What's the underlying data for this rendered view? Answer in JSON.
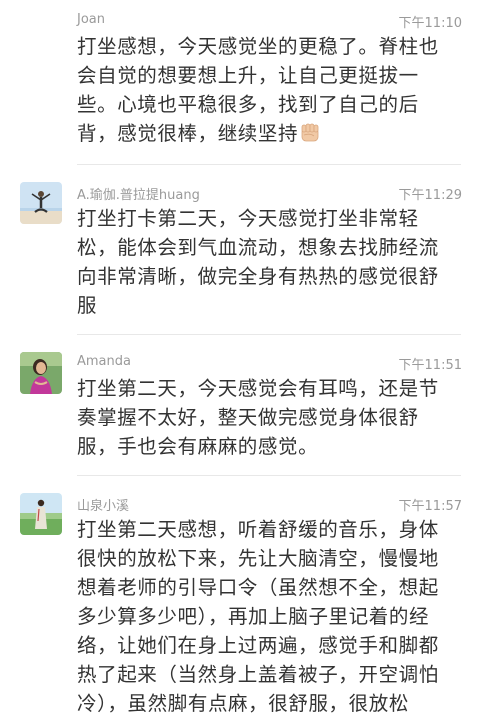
{
  "comments": [
    {
      "name": "Joan",
      "time": "下午11:10",
      "text": "打坐感想，今天感觉坐的更稳了。脊柱也会自觉的想要想上升，让自己更挺拔一些。心境也平稳很多，找到了自己的后背，感觉很棒，继续坚持",
      "emoji": "fist-emoji-icon"
    },
    {
      "name": "A.瑜伽.普拉提huang",
      "time": "下午11:29",
      "text": "打坐打卡第二天，今天感觉打坐非常轻松，能体会到气血流动，想象去找肺经流向非常清晰，做完全身有热热的感觉很舒服"
    },
    {
      "name": "Amanda",
      "time": "下午11:51",
      "text": "打坐第二天，今天感觉会有耳鸣，还是节奏掌握不太好，整天做完感觉身体很舒服，手也会有麻麻的感觉。"
    },
    {
      "name": "山泉小溪",
      "time": "下午11:57",
      "text": "打坐第二天感想，听着舒缓的音乐，身体很快的放松下来，先让大脑清空，慢慢地想着老师的引导口令（虽然想不全，想起多少算多少吧），再加上脑子里记着的经络，让她们在身上过两遍，感觉手和脚都热了起来（当然身上盖着被子，开空调怕冷），虽然脚有点麻，很舒服，很放松"
    }
  ]
}
